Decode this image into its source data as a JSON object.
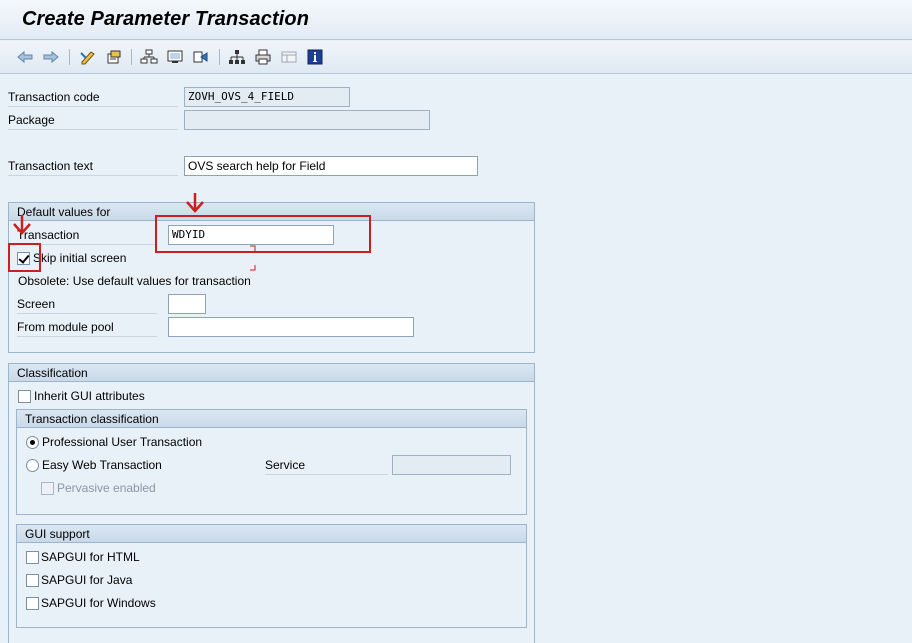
{
  "title": "Create Parameter Transaction",
  "toolbar": {
    "icons": [
      "back-arrow-icon",
      "forward-arrow-icon",
      "pen-icon",
      "object-list-icon",
      "hierarchy-icon",
      "display-icon",
      "other-object-icon",
      "org-chart-icon",
      "print-icon",
      "layout-icon",
      "info-icon"
    ]
  },
  "header": {
    "tcode_label": "Transaction code",
    "tcode_value": "ZOVH_OVS_4_FIELD",
    "package_label": "Package",
    "package_value": "",
    "ttext_label": "Transaction text",
    "ttext_value": "OVS search help for Field"
  },
  "defaults": {
    "title": "Default values for",
    "transaction_label": "Transaction",
    "transaction_value": "WDYID",
    "skip_label": "Skip initial screen",
    "skip_checked": true,
    "obsolete_text": "Obsolete: Use default values for transaction",
    "screen_label": "Screen",
    "screen_value": "",
    "module_label": "From module pool",
    "module_value": ""
  },
  "classification": {
    "title": "Classification",
    "inherit_label": "Inherit GUI attributes",
    "tc_title": "Transaction classification",
    "professional_label": "Professional User Transaction",
    "easyweb_label": "Easy Web Transaction",
    "service_label": "Service",
    "service_value": "",
    "pervasive_label": "Pervasive enabled",
    "selected": "professional"
  },
  "gui_support": {
    "title": "GUI support",
    "html_label": "SAPGUI for HTML",
    "java_label": "SAPGUI for Java",
    "windows_label": "SAPGUI for Windows"
  },
  "colors": {
    "annotation": "#cc1f1f",
    "background": "#e8f1f8"
  }
}
